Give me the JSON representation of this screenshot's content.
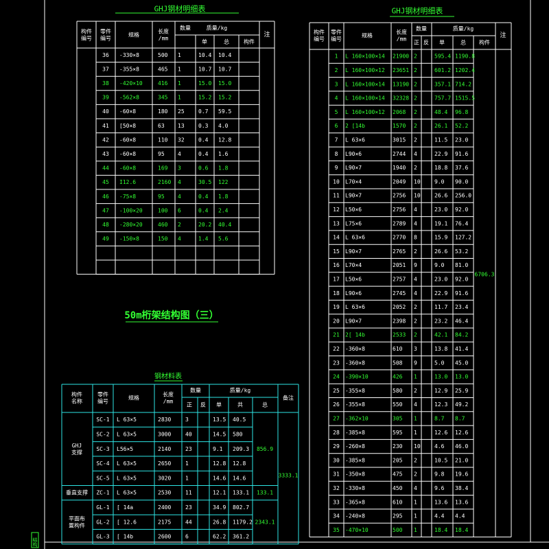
{
  "colors": {
    "background": "#000000",
    "grid": "#ffffff",
    "table3_grid": "#2ee6e6",
    "text": "#ffffff",
    "highlight": "#33ff33"
  },
  "t1": {
    "title": "GHJ钢材明细表",
    "h_member": "构件\n编号",
    "h_part": "零件\n编号",
    "h_spec": "规格",
    "h_length": "长度\n/mm",
    "h_qty": "数量",
    "h_mass": "质量/kg",
    "h_unit": "单",
    "h_total": "总",
    "h_comp": "构件",
    "h_note": "注",
    "rows": [
      [
        "36",
        "-330×8",
        "500",
        "1",
        "10.4",
        "10.4",
        0
      ],
      [
        "37",
        "-355×8",
        "465",
        "1",
        "10.7",
        "10.7",
        0
      ],
      [
        "38",
        "-420×10",
        "416",
        "1",
        "15.0",
        "15.0",
        1
      ],
      [
        "39",
        "-562×8",
        "345",
        "1",
        "15.2",
        "15.2",
        1
      ],
      [
        "40",
        "-60×8",
        "180",
        "25",
        "0.7",
        "59.5",
        0
      ],
      [
        "41",
        "[50×8",
        "63",
        "13",
        "0.3",
        "4.0",
        0
      ],
      [
        "42",
        "-60×8",
        "110",
        "32",
        "0.4",
        "12.8",
        0
      ],
      [
        "43",
        "-60×8",
        "95",
        "4",
        "0.4",
        "1.6",
        0
      ],
      [
        "44",
        "-60×8",
        "169",
        "3",
        "0.6",
        "1.8",
        1
      ],
      [
        "45",
        "I12.6",
        "2160",
        "4",
        "30.5",
        "122",
        1
      ],
      [
        "46",
        "-75×8",
        "95",
        "4",
        "0.4",
        "1.8",
        1
      ],
      [
        "47",
        "-100×20",
        "100",
        "6",
        "0.4",
        "2.4",
        1
      ],
      [
        "48",
        "-280×20",
        "460",
        "2",
        "20.2",
        "40.4",
        1
      ],
      [
        "49",
        "-150×8",
        "150",
        "4",
        "1.4",
        "5.6",
        1
      ],
      [
        "",
        "",
        "",
        "",
        "",
        "",
        0
      ],
      [
        "",
        "",
        "",
        "",
        "",
        "",
        0
      ]
    ]
  },
  "t2": {
    "title": "GHJ钢材明细表",
    "h_member": "构件\n编号",
    "h_part": "零件\n编号",
    "h_spec": "规格",
    "h_length": "长度\n/mm",
    "h_qty": "数量",
    "h_pos": "正",
    "h_neg": "反",
    "h_mass": "质量/kg",
    "h_unit": "单",
    "h_total": "总",
    "h_comp": "构件",
    "h_note": "注",
    "comp_total": "6706.3",
    "rows": [
      [
        "1",
        "L 160×100×14",
        "21900",
        "2",
        "595.4",
        "1190.8",
        1
      ],
      [
        "2",
        "L 160×100×12",
        "23651",
        "2",
        "601.2",
        "1202.4",
        1
      ],
      [
        "3",
        "L 160×100×14",
        "13190",
        "2",
        "357.1",
        "714.2",
        1
      ],
      [
        "4",
        "L 160×100×14",
        "32328",
        "2",
        "757.7",
        "1515.5",
        1
      ],
      [
        "5",
        "L 160×100×12",
        "2068",
        "2",
        "48.4",
        "96.8",
        1
      ],
      [
        "6",
        "2 [14b",
        "1570",
        "2",
        "26.1",
        "52.2",
        1
      ],
      [
        "7",
        "L 63×6",
        "3015",
        "2",
        "11.5",
        "23.0",
        0
      ],
      [
        "8",
        "L90×6",
        "2744",
        "4",
        "22.9",
        "91.6",
        0
      ],
      [
        "9",
        "L90×7",
        "1940",
        "2",
        "18.8",
        "37.6",
        0
      ],
      [
        "10",
        "L70×4",
        "2049",
        "10",
        "9.0",
        "90.0",
        0
      ],
      [
        "11",
        "L90×7",
        "2756",
        "10",
        "26.6",
        "256.0",
        0
      ],
      [
        "12",
        "L50×6",
        "2756",
        "4",
        "23.0",
        "92.0",
        0
      ],
      [
        "13",
        "L75×6",
        "2789",
        "4",
        "19.1",
        "76.4",
        0
      ],
      [
        "14",
        "L 63×6",
        "2770",
        "8",
        "15.9",
        "127.2",
        0
      ],
      [
        "15",
        "L90×7",
        "2765",
        "2",
        "26.6",
        "53.2",
        0
      ],
      [
        "16",
        "L70×4",
        "2051",
        "9",
        "9.0",
        "81.0",
        0
      ],
      [
        "17",
        "L50×6",
        "2757",
        "4",
        "23.0",
        "92.0",
        0
      ],
      [
        "18",
        "L90×6",
        "2745",
        "4",
        "22.9",
        "91.6",
        0
      ],
      [
        "19",
        "L 63×6",
        "2052",
        "2",
        "11.7",
        "23.4",
        0
      ],
      [
        "20",
        "L90×7",
        "2398",
        "2",
        "23.2",
        "46.4",
        0
      ],
      [
        "21",
        "2[ 14b",
        "2533",
        "2",
        "42.1",
        "84.2",
        1
      ],
      [
        "22",
        "-360×8",
        "610",
        "3",
        "13.8",
        "41.4",
        0
      ],
      [
        "23",
        "-360×8",
        "508",
        "9",
        "5.0",
        "45.0",
        0
      ],
      [
        "24",
        "-390×10",
        "426",
        "1",
        "13.0",
        "13.0",
        1
      ],
      [
        "25",
        "-355×8",
        "580",
        "2",
        "12.9",
        "25.9",
        0
      ],
      [
        "26",
        "-355×8",
        "550",
        "4",
        "12.3",
        "49.2",
        0
      ],
      [
        "27",
        "-362×10",
        "305",
        "1",
        "8.7",
        "8.7",
        1
      ],
      [
        "28",
        "-385×8",
        "595",
        "1",
        "12.6",
        "12.6",
        0
      ],
      [
        "29",
        "-260×8",
        "230",
        "10",
        "4.6",
        "46.0",
        0
      ],
      [
        "30",
        "-385×8",
        "205",
        "2",
        "10.5",
        "21.0",
        0
      ],
      [
        "31",
        "-350×8",
        "475",
        "2",
        "9.8",
        "19.6",
        0
      ],
      [
        "32",
        "-330×8",
        "450",
        "4",
        "9.6",
        "38.4",
        0
      ],
      [
        "33",
        "-365×8",
        "610",
        "1",
        "13.6",
        "13.6",
        0
      ],
      [
        "34",
        "-240×8",
        "295",
        "1",
        "4.4",
        "4.4",
        0
      ],
      [
        "35",
        "-470×10",
        "500",
        "1",
        "18.4",
        "18.4",
        1
      ]
    ]
  },
  "drawing_title": "50m桁架结构图（三）",
  "t3": {
    "title": "钢材料表",
    "h_member": "构件\n名称",
    "h_part": "零件\n编号",
    "h_spec": "规格",
    "h_length": "长度\n/mm",
    "h_qty": "数量",
    "h_pos": "正",
    "h_neg": "反",
    "h_mass": "质量/kg",
    "h_unit": "单",
    "h_total": "共",
    "h_sum": "总",
    "h_note": "备注",
    "groups": [
      "GHJ\n支撑",
      "垂直支撑",
      "平面布\n置构件"
    ],
    "rows": [
      [
        "SC-1",
        "L 63×5",
        "2830",
        "3",
        "13.5",
        "40.5"
      ],
      [
        "SC-2",
        "L 63×5",
        "3000",
        "40",
        "14.5",
        "580"
      ],
      [
        "SC-3",
        "L56×5",
        "2140",
        "23",
        "9.1",
        "209.3"
      ],
      [
        "SC-4",
        "L 63×5",
        "2650",
        "1",
        "12.8",
        "12.8"
      ],
      [
        "SC-5",
        "L 63×5",
        "3020",
        "1",
        "14.6",
        "14.6"
      ],
      [
        "ZC-1",
        "L 63×5",
        "2530",
        "11",
        "12.1",
        "133.1"
      ],
      [
        "GL-1",
        "[ 14a",
        "2400",
        "23",
        "34.9",
        "802.7"
      ],
      [
        "GL-2",
        "[ 12.6",
        "2175",
        "44",
        "26.8",
        "1179.2"
      ],
      [
        "GL-3",
        "[ 14b",
        "2600",
        "6",
        "62.2",
        "361.2"
      ]
    ],
    "sum_sc": "856.9",
    "sum_zc": "133.1",
    "sum_gl": "2343.1",
    "sum_all": "3333.1"
  },
  "stamp": "结构"
}
